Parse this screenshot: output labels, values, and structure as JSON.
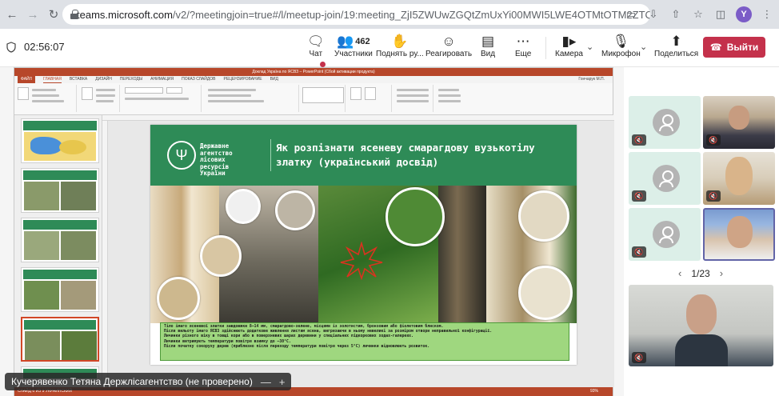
{
  "browser": {
    "url_host": "teams.microsoft.com",
    "url_path": "/v2/?meetingjoin=true#/l/meetup-join/19:meeting_ZjI5ZWUwZGQtZmUxYi00MWI5LWE4OTMtOTM2ZTQyNjI3YT...",
    "profile_initial": "Y"
  },
  "meeting": {
    "timer": "02:56:07",
    "participants_count": "462",
    "chat": "Чат",
    "participants": "Участники",
    "raise_hand": "Поднять ру...",
    "react": "Реагировать",
    "view": "Вид",
    "more": "Еще",
    "camera": "Камера",
    "mic": "Микрофон",
    "share": "Поделиться",
    "leave": "Выйти"
  },
  "ppt": {
    "window_title": "Доклад Україна по ЯСВЗ – PowerPoint (Сбой активации продукта)",
    "tabs": [
      "ФАЙЛ",
      "ГЛАВНАЯ",
      "ВСТАВКА",
      "ДИЗАЙН",
      "ПЕРЕХОДЫ",
      "АНИМАЦИЯ",
      "ПОКАЗ СЛАЙДОВ",
      "РЕЦЕНЗИРОВАНИЕ",
      "ВИД"
    ],
    "user": "Гончарук М.П.",
    "status_left": "СЛАЙД 6 ИЗ 9    УКРАИНСКИЙ",
    "zoom": "93%",
    "thumb_numbers": [
      "2",
      "3",
      "4",
      "5",
      "6",
      "7"
    ]
  },
  "slide": {
    "agency_lines": [
      "Державне",
      "агентство",
      "лісових",
      "ресурсів",
      "України"
    ],
    "title": "Як розпізнати ясеневу смарагдову вузькотілу златку (український досвід)",
    "text_lines": [
      "Тіло імаго ясеневої златки завдовжки 8–14 мм, смарагдово-зелене, місцями із золотистим, бронзовим або фіолетовим блиском.",
      "Після вильоту імаго ЯСВЗ здійснюють додаткове живлення листям ясена, вигризаючи в ньому невеликі за розміром отвори неправильної конфігурації.",
      "Личинки різного віку в товщі кори або в поверхневих шарах деревини у спеціальних підкоркових ходах-галереях.",
      "Личинки витримують температури повітря взимку до –30°C.",
      "Після початку сокоруху дерев (приблизно після переходу температури повітря через 5°C) личинки відновлюють розвиток."
    ]
  },
  "presenter": {
    "name": "Кучерявенко Тетяна Держлісагентство (не проверено)"
  },
  "gallery": {
    "pager": "1/23"
  },
  "colors": {
    "leave": "#c4314b",
    "slide_green": "#2e8b57",
    "ppt_red": "#b7472a",
    "text_box": "#9fd77f"
  }
}
